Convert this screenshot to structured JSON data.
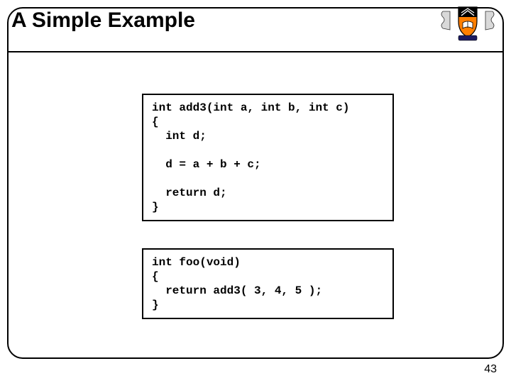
{
  "title": "A Simple Example",
  "code_block_1": "int add3(int a, int b, int c)\n{\n  int d;\n\n  d = a + b + c;\n\n  return d;\n}",
  "code_block_2": "int foo(void)\n{\n  return add3( 3, 4, 5 ); \n}",
  "page_number": "43",
  "logo_alt": "princeton-shield"
}
